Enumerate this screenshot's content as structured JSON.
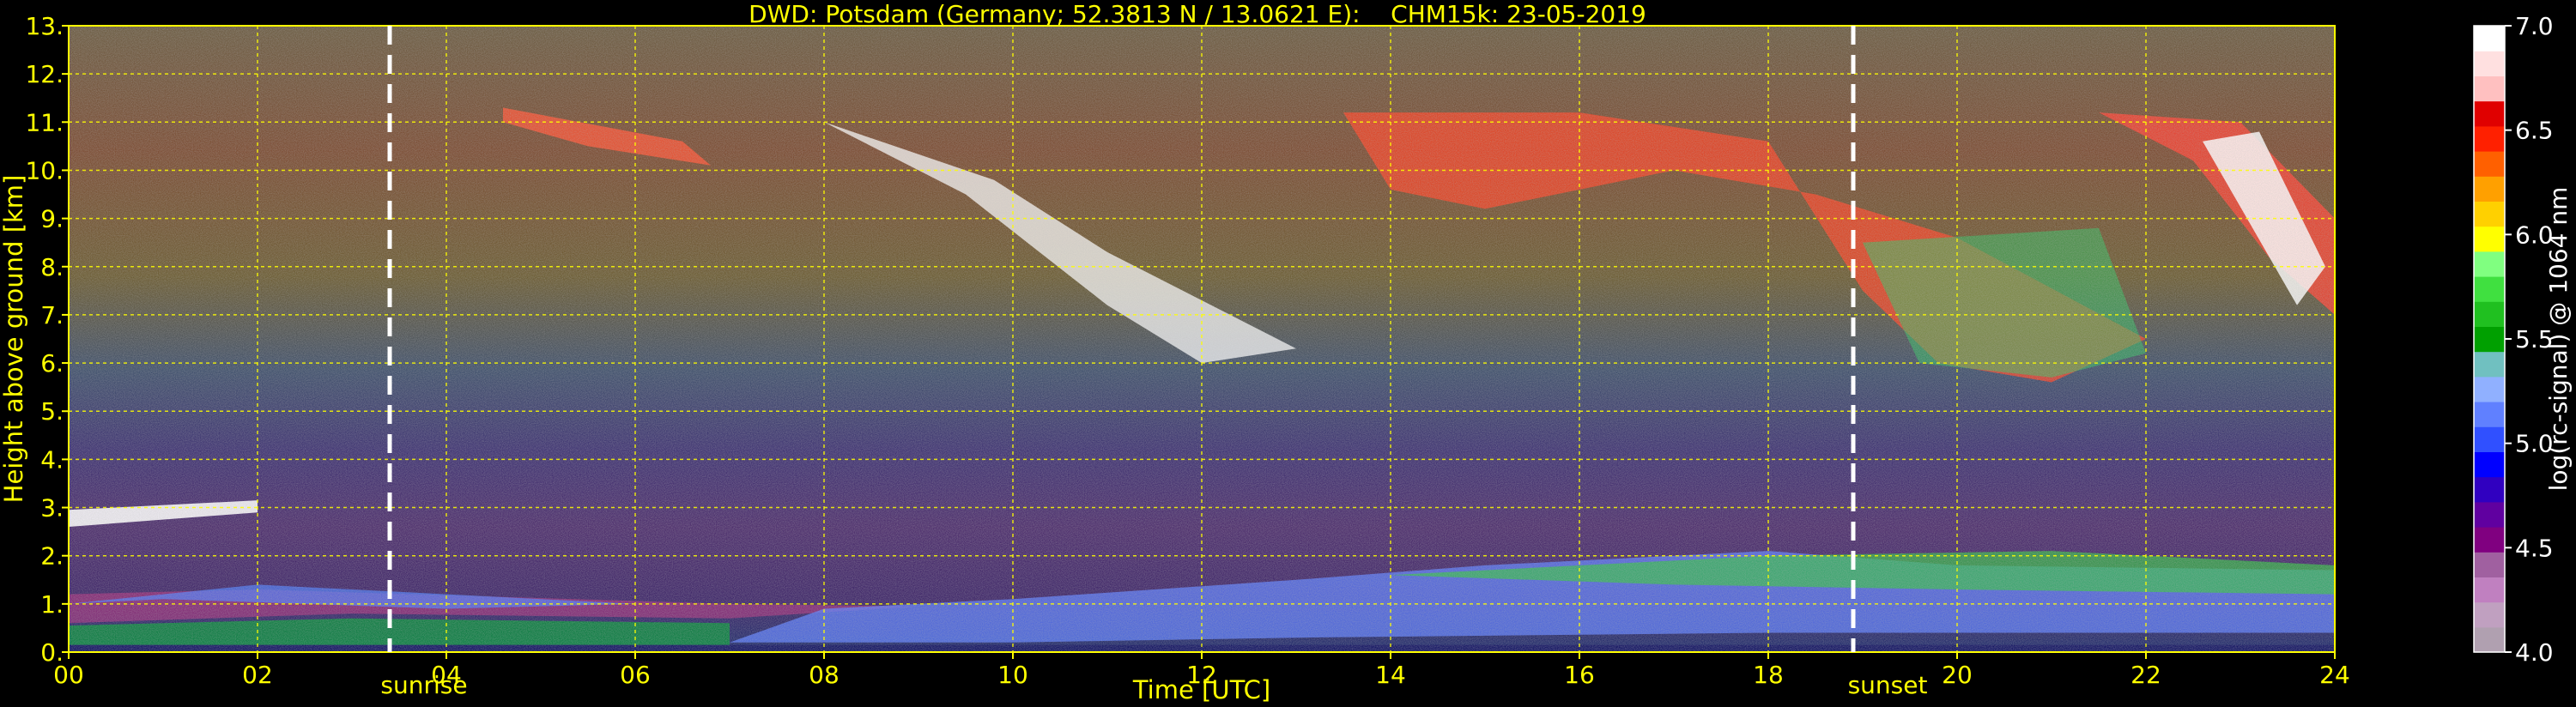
{
  "title": "DWD: Potsdam (Germany; 52.3813 N / 13.0621 E):    CHM15k: 23-05-2019",
  "chart_data": {
    "type": "heatmap",
    "title": "DWD: Potsdam (Germany; 52.3813 N / 13.0621 E):    CHM15k: 23-05-2019",
    "xlabel": "Time [UTC]",
    "ylabel": "Height above ground [km]",
    "colorbar_label": "log(rc-signal) @ 1064 nm",
    "xlim": [
      0,
      24
    ],
    "ylim": [
      0,
      13
    ],
    "clim": [
      4.0,
      7.0
    ],
    "x_ticks": [
      0,
      2,
      4,
      6,
      8,
      10,
      12,
      14,
      16,
      18,
      20,
      22,
      24
    ],
    "x_tick_labels": [
      "00",
      "02",
      "04",
      "06",
      "08",
      "10",
      "12",
      "14",
      "16",
      "18",
      "20",
      "22",
      "24"
    ],
    "y_ticks": [
      0,
      1,
      2,
      3,
      4,
      5,
      6,
      7,
      8,
      9,
      10,
      11,
      12,
      13
    ],
    "y_tick_labels": [
      "0.",
      "1.",
      "2.",
      "3.",
      "4.",
      "5.",
      "6.",
      "7.",
      "8.",
      "9.",
      "10.",
      "11.",
      "12.",
      "13."
    ],
    "cbar_ticks": [
      4.0,
      4.5,
      5.0,
      5.5,
      6.0,
      6.5,
      7.0
    ],
    "cbar_tick_labels": [
      "4.0",
      "4.5",
      "5.0",
      "5.5",
      "6.0",
      "6.5",
      "7.0"
    ],
    "grid": true,
    "grid_color": "#ffff00",
    "text_color": "#ffff00",
    "background": "#000000",
    "annotations": [
      {
        "label": "sunrise",
        "x": 3.4
      },
      {
        "label": "sunset",
        "x": 18.9
      }
    ],
    "colormap": [
      "#b0a0b0",
      "#c0a0c0",
      "#c080c0",
      "#a060a0",
      "#800080",
      "#6000a0",
      "#3000c0",
      "#0000ff",
      "#3050ff",
      "#6080ff",
      "#90b0ff",
      "#70c0c0",
      "#00a000",
      "#20c020",
      "#40e040",
      "#80ff80",
      "#ffff00",
      "#ffd000",
      "#ffa000",
      "#ff6000",
      "#ff2000",
      "#e00000",
      "#ffc0c0",
      "#ffe0e0",
      "#ffffff"
    ]
  }
}
